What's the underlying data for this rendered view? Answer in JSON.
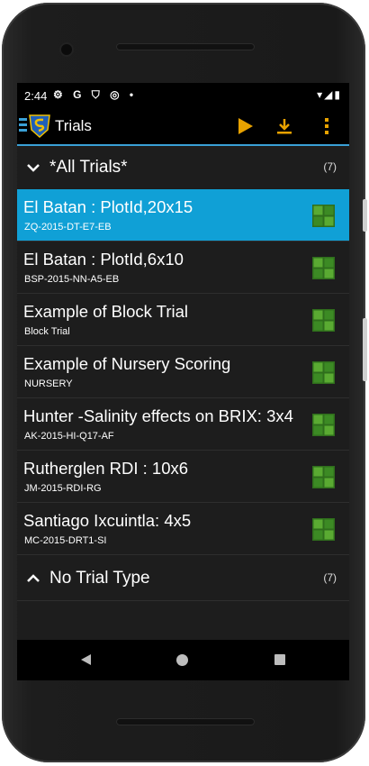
{
  "status": {
    "time": "2:44",
    "left_icons": "⚙ G ⛉ ◎ •",
    "right_icons": "▾◢▮"
  },
  "toolbar": {
    "title": "Trials",
    "accent_color": "#e8a200"
  },
  "groups": [
    {
      "label": "*All Trials*",
      "count": "(7)",
      "expanded": true
    },
    {
      "label": "No Trial Type",
      "count": "(7)",
      "expanded": false
    }
  ],
  "trials": [
    {
      "name": "El Batan : PlotId,20x15",
      "code": "ZQ-2015-DT-E7-EB",
      "selected": true
    },
    {
      "name": "El Batan : PlotId,6x10",
      "code": "BSP-2015-NN-A5-EB",
      "selected": false
    },
    {
      "name": "Example of Block Trial",
      "code": "Block Trial",
      "selected": false
    },
    {
      "name": "Example of Nursery Scoring",
      "code": "NURSERY",
      "selected": false
    },
    {
      "name": "Hunter -Salinity effects on BRIX: 3x4",
      "code": "AK-2015-HI-Q17-AF",
      "selected": false
    },
    {
      "name": "Rutherglen RDI : 10x6",
      "code": "JM-2015-RDI-RG",
      "selected": false
    },
    {
      "name": "Santiago Ixcuintla: 4x5",
      "code": "MC-2015-DRT1-SI",
      "selected": false
    }
  ],
  "colors": {
    "selected_row": "#10a0d6",
    "toolbar_underline": "#3aa0d6",
    "grid_icon": "#5aaa32"
  }
}
